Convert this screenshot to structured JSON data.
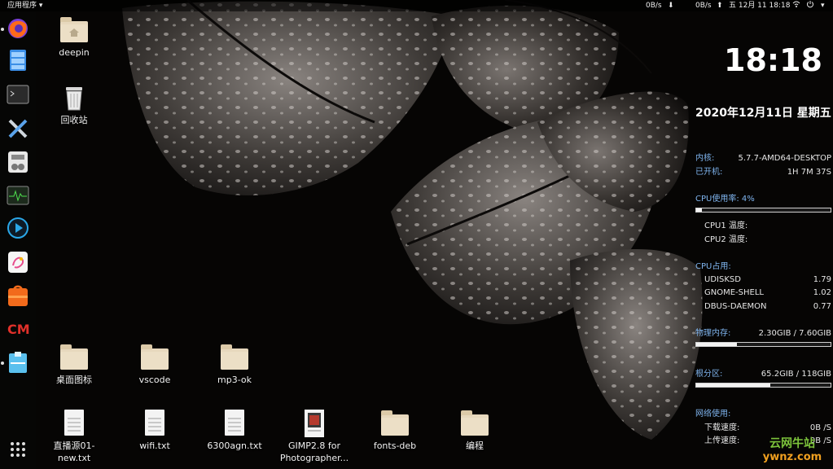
{
  "topbar": {
    "app_menu": "应用程序",
    "net_left": "0B/s",
    "net_right": "0B/s",
    "datetime": "五 12月 11  18:18"
  },
  "desktop_icons": {
    "deepin": "deepin",
    "trash": "回收站",
    "desktop_folder": "桌面图标",
    "vscode": "vscode",
    "mp3ok": "mp3-ok",
    "live_txt": "直播源01-new.txt",
    "wifi_txt": "wifi.txt",
    "agn_txt": "6300agn.txt",
    "gimp": "GIMP2.8 for Photographer...",
    "fonts_deb": "fonts-deb",
    "biancheng": "编程"
  },
  "conky": {
    "time": "18:18",
    "date": "2020年12月11日 星期五",
    "kernel_label": "内核:",
    "kernel_value": "5.7.7-AMD64-DESKTOP",
    "uptime_label": "已开机:",
    "uptime_value": "1H 7M 37S",
    "cpu_usage_label": "CPU使用率: 4%",
    "cpu_usage_fraction": 0.04,
    "cpu1_temp": "CPU1 温度:",
    "cpu2_temp": "CPU2 温度:",
    "cpu_top_label": "CPU占用:",
    "procs": [
      {
        "name": "UDISKSD",
        "value": "1.79"
      },
      {
        "name": "GNOME-SHELL",
        "value": "1.02"
      },
      {
        "name": "DBUS-DAEMON",
        "value": "0.77"
      }
    ],
    "mem_label": "物理内存:",
    "mem_value": "2.30GIB / 7.60GIB",
    "mem_fraction": 0.3,
    "root_label": "根分区:",
    "root_value": "65.2GIB / 118GIB",
    "root_fraction": 0.55,
    "net_label": "网络使用:",
    "download_label": "下载速度:",
    "download_value": "0B  /S",
    "upload_label": "上传速度:",
    "upload_value": "0B  /S"
  },
  "watermark": {
    "line1": "云网牛站",
    "line2": "ywnz.com"
  },
  "colors": {
    "accent_blue": "#7fb4ee",
    "watermark_green": "#7cc33b",
    "watermark_orange": "#f0a020"
  }
}
